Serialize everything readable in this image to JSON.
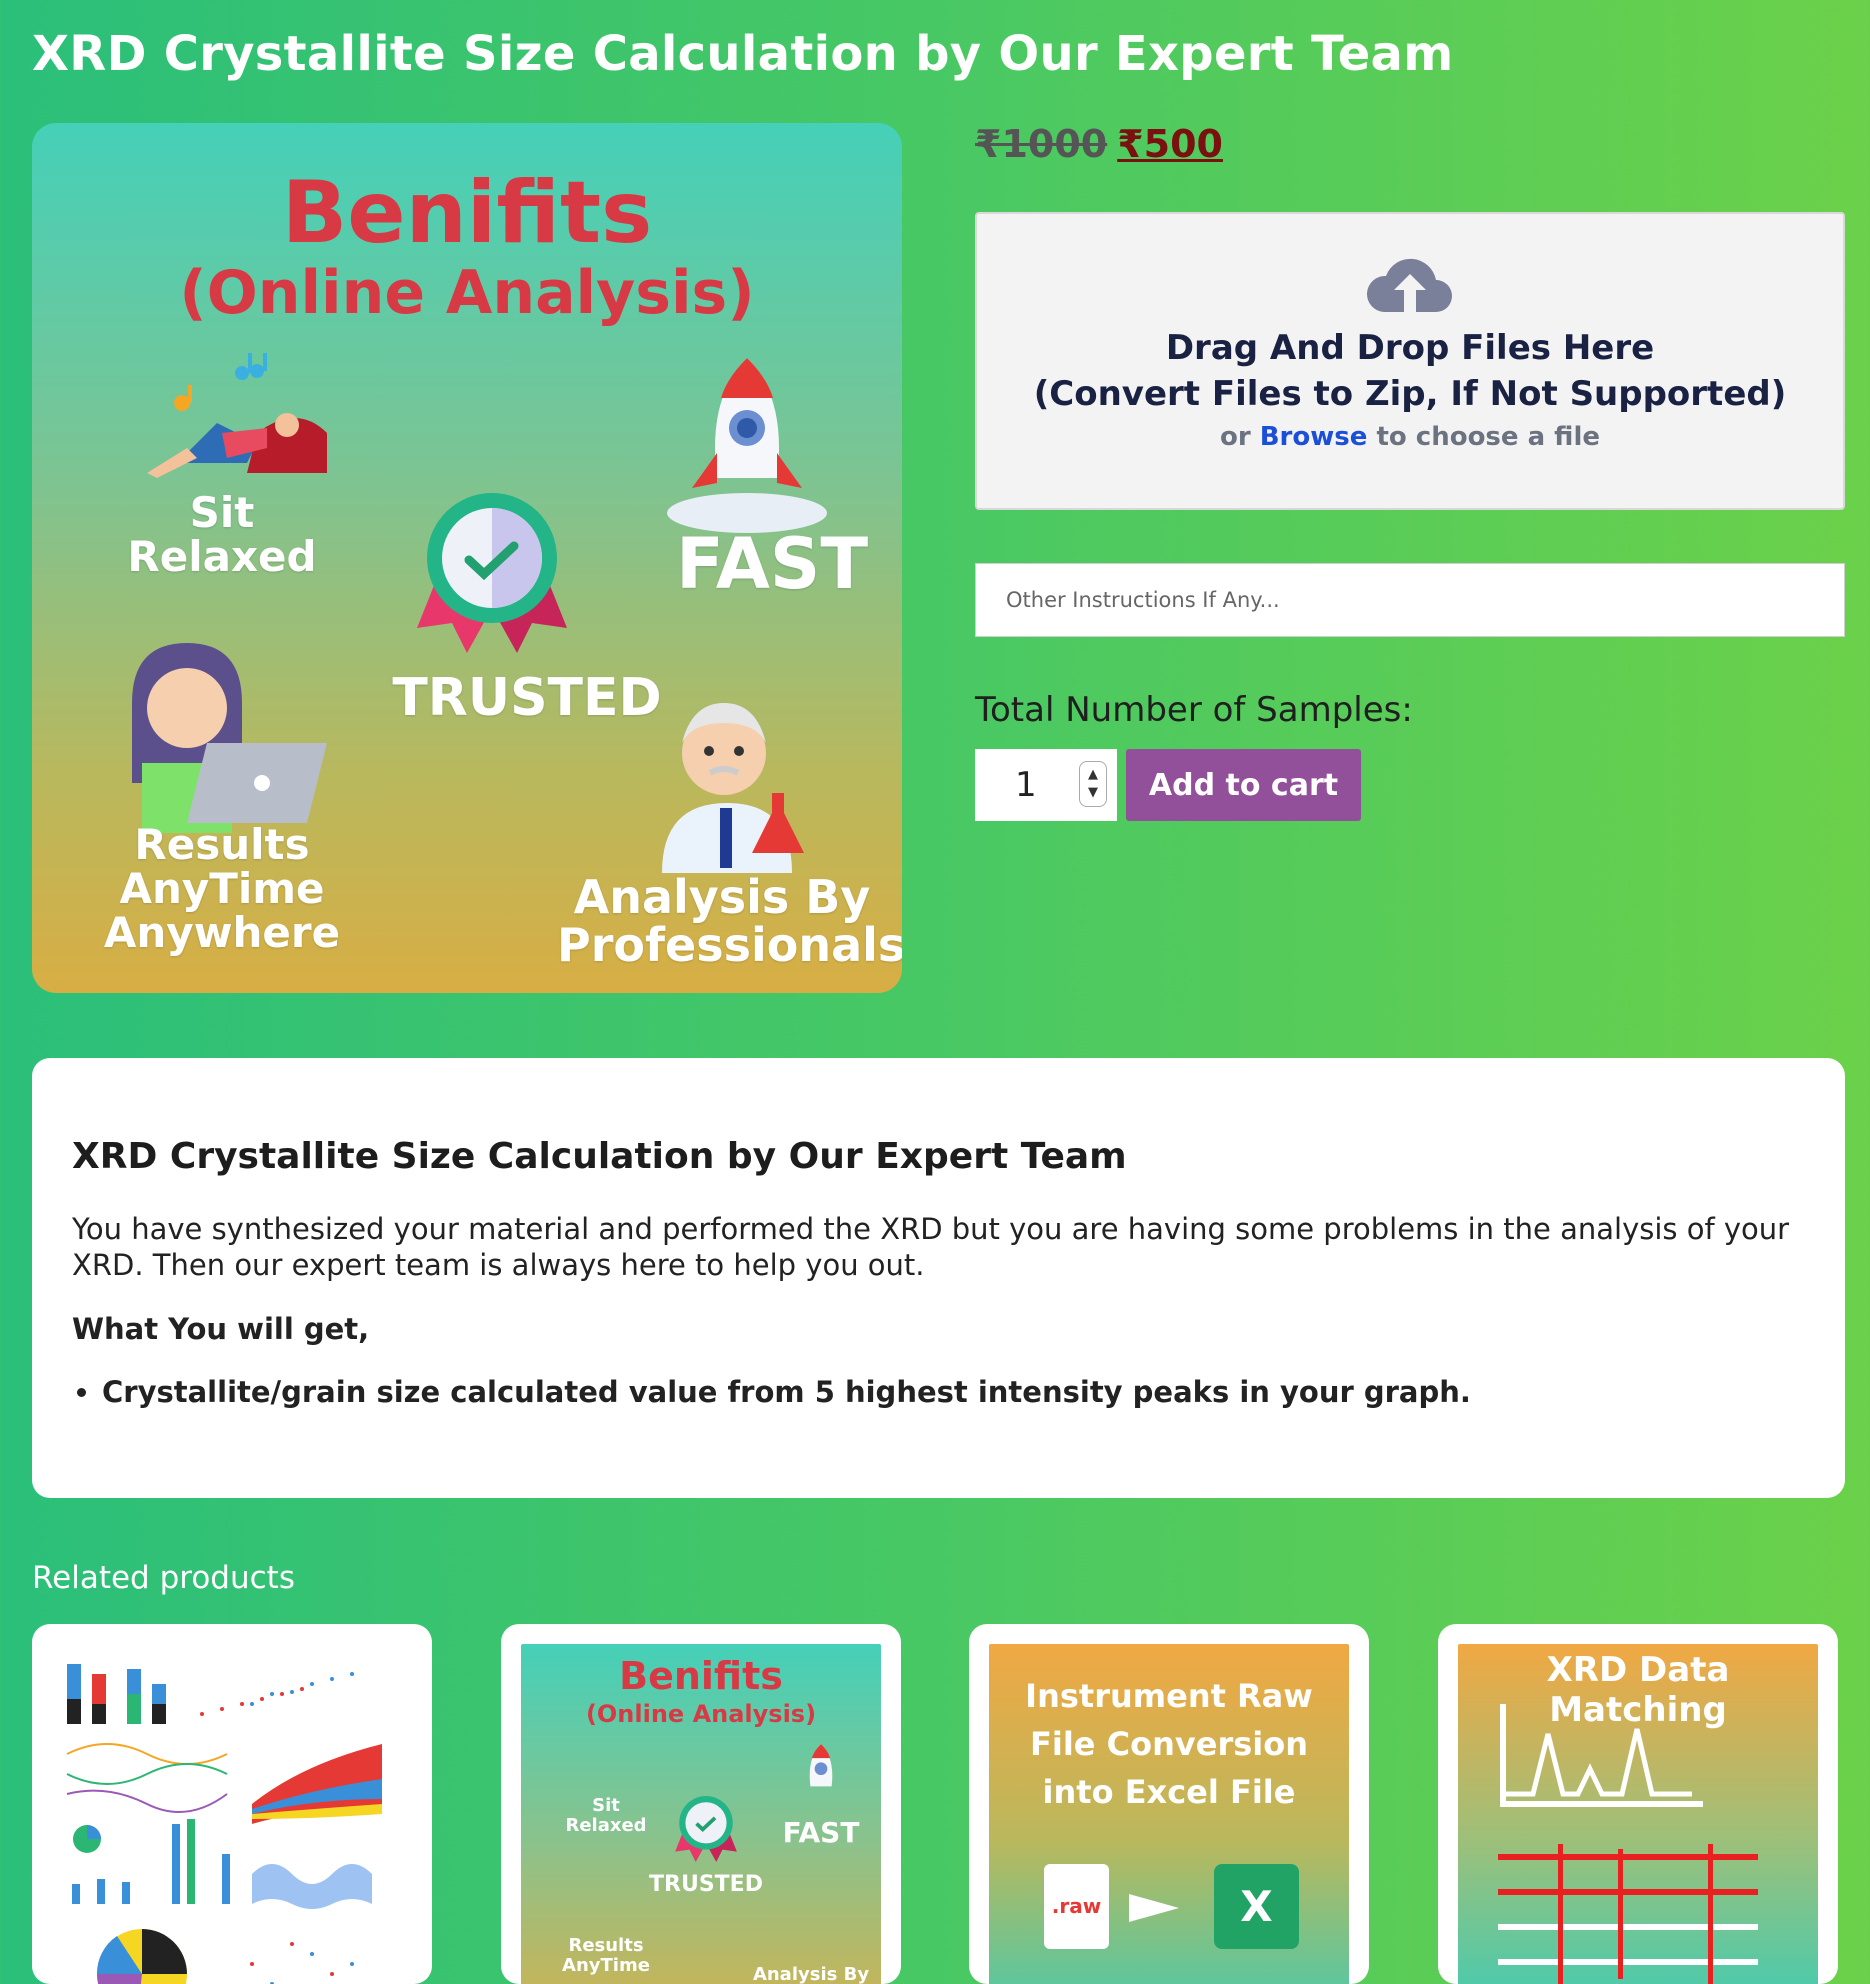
{
  "page": {
    "title": "XRD Crystallite Size Calculation by Our Expert Team"
  },
  "hero": {
    "title": "Benifits",
    "subtitle": "(Online Analysis)",
    "labels": {
      "relaxed": "Sit Relaxed",
      "fast": "FAST",
      "trusted": "TRUSTED",
      "results": "Results AnyTime Anywhere",
      "professionals": "Analysis By Professionals"
    }
  },
  "price": {
    "old": "₹1000",
    "new": "₹500"
  },
  "dropzone": {
    "line1": "Drag And Drop Files Here",
    "line2": "(Convert Files to Zip, If Not Supported)",
    "or": "or",
    "browse": "Browse",
    "tail": "to choose a file"
  },
  "instructions": {
    "placeholder": "Other Instructions If Any..."
  },
  "samples": {
    "label": "Total Number of Samples:",
    "value": "1"
  },
  "cart": {
    "button": "Add to cart"
  },
  "description": {
    "heading": "XRD Crystallite Size Calculation by Our Expert Team",
    "body": "You have synthesized your material and performed the XRD but you are having some problems in the analysis of your XRD. Then our expert team is always here to help you out.",
    "get_title": "What You will get,",
    "bullets": [
      "Crystallite/grain size calculated value from 5 highest intensity peaks in your graph."
    ]
  },
  "related": {
    "title": "Related products",
    "cards": [
      {
        "caption": ""
      },
      {
        "title": "Benifits",
        "subtitle": "(Online Analysis)",
        "relaxed": "Sit Relaxed",
        "fast": "FAST",
        "trusted": "TRUSTED",
        "results": "Results AnyTime",
        "professionals": "Analysis By"
      },
      {
        "caption": "Instrument Raw File Conversion into Excel File",
        "raw": ".raw",
        "excel": "X"
      },
      {
        "caption": "XRD Data Matching"
      }
    ]
  }
}
